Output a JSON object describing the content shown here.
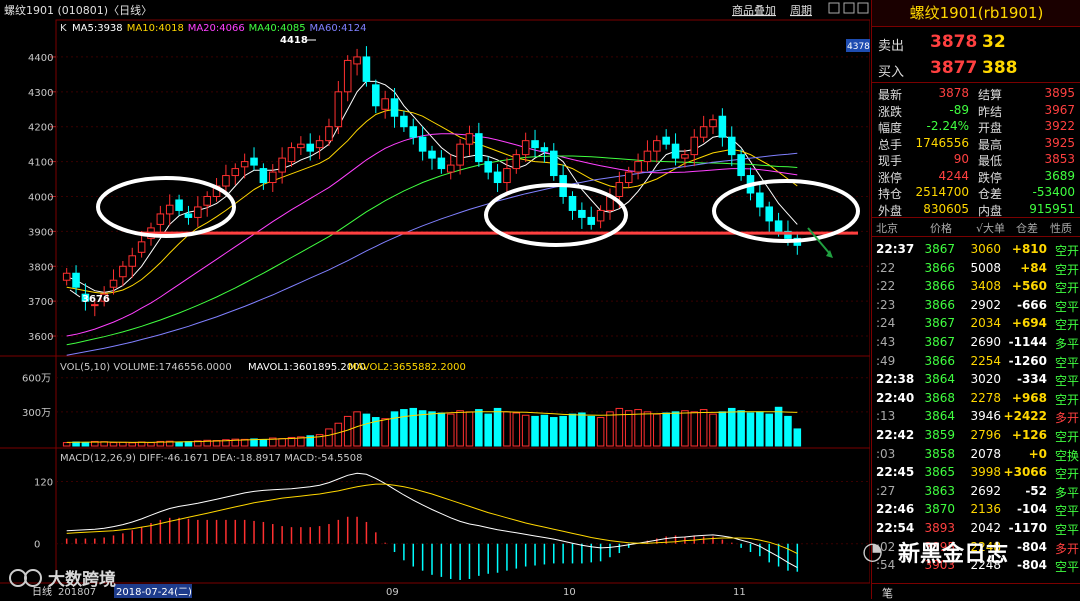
{
  "header": {
    "title": "螺纹1901 (010801)〈日线〉",
    "links": [
      "商品叠加",
      "周期"
    ],
    "ma_label": "K",
    "ma": [
      {
        "name": "MA5:3938",
        "color": "#ffffff"
      },
      {
        "name": "MA10:4018",
        "color": "#ffd700"
      },
      {
        "name": "MA20:4066",
        "color": "#ff40ff"
      },
      {
        "name": "MA40:4085",
        "color": "#40ff40"
      },
      {
        "name": "MA60:4124",
        "color": "#8080ff"
      }
    ],
    "price_tag": "4378"
  },
  "colors": {
    "up": "#ff3030",
    "down": "#00ffff",
    "support": "#ff4040",
    "arrow": "#20a040"
  },
  "chart_data": [
    {
      "type": "candlestick",
      "ylim": [
        3560,
        4460
      ],
      "yticks": [
        3600,
        3700,
        3800,
        3900,
        4000,
        4100,
        4200,
        4300,
        4400
      ],
      "high_label": "4418",
      "low_label": "3676",
      "support_level": 3895,
      "closes": [
        3780,
        3740,
        3700,
        3690,
        3720,
        3760,
        3800,
        3830,
        3870,
        3910,
        3950,
        3975,
        3960,
        3940,
        3970,
        4000,
        4030,
        4060,
        4080,
        4100,
        4090,
        4040,
        4070,
        4110,
        4140,
        4150,
        4130,
        4160,
        4200,
        4300,
        4390,
        4400,
        4330,
        4260,
        4280,
        4230,
        4200,
        4170,
        4130,
        4110,
        4080,
        4090,
        4150,
        4180,
        4100,
        4070,
        4040,
        4080,
        4120,
        4160,
        4140,
        4130,
        4060,
        4000,
        3960,
        3940,
        3920,
        3960,
        4000,
        4040,
        4070,
        4100,
        4130,
        4160,
        4150,
        4110,
        4120,
        4170,
        4200,
        4220,
        4170,
        4120,
        4060,
        4010,
        3970,
        3930,
        3900,
        3880,
        3860
      ],
      "opens": [
        3760,
        3780,
        3720,
        3690,
        3700,
        3740,
        3770,
        3800,
        3840,
        3880,
        3920,
        3950,
        3990,
        3950,
        3940,
        3975,
        4000,
        4030,
        4060,
        4085,
        4110,
        4080,
        4040,
        4070,
        4100,
        4140,
        4150,
        4140,
        4160,
        4200,
        4300,
        4380,
        4400,
        4320,
        4250,
        4280,
        4230,
        4200,
        4170,
        4130,
        4110,
        4070,
        4090,
        4150,
        4180,
        4100,
        4070,
        4040,
        4080,
        4120,
        4160,
        4140,
        4130,
        4060,
        4000,
        3960,
        3940,
        3930,
        3960,
        4000,
        4040,
        4070,
        4100,
        4130,
        4170,
        4150,
        4110,
        4120,
        4170,
        4200,
        4230,
        4170,
        4120,
        4060,
        4010,
        3970,
        3930,
        3900,
        3880
      ],
      "ma_series": [
        {
          "name": "MA5",
          "color": "#ffffff",
          "values": [
            3770,
            3760,
            3745,
            3730,
            3725,
            3730,
            3745,
            3770,
            3800,
            3840,
            3880,
            3920,
            3945,
            3955,
            3960,
            3968,
            3980,
            4000,
            4030,
            4060,
            4075,
            4075,
            4075,
            4080,
            4090,
            4105,
            4115,
            4130,
            4150,
            4200,
            4250,
            4300,
            4330,
            4330,
            4320,
            4300,
            4260,
            4230,
            4200,
            4170,
            4140,
            4120,
            4110,
            4115,
            4120,
            4115,
            4105,
            4090,
            4080,
            4090,
            4110,
            4125,
            4120,
            4100,
            4060,
            4020,
            3990,
            3960,
            3955,
            3965,
            3985,
            4015,
            4050,
            4090,
            4120,
            4130,
            4130,
            4135,
            4150,
            4170,
            4175,
            4165,
            4140,
            4100,
            4060,
            4020,
            3980,
            3950,
            3920
          ]
        },
        {
          "name": "MA10",
          "color": "#ffd700",
          "values": [
            3740,
            3735,
            3730,
            3725,
            3722,
            3725,
            3732,
            3745,
            3762,
            3785,
            3810,
            3838,
            3865,
            3890,
            3910,
            3925,
            3942,
            3960,
            3980,
            4000,
            4020,
            4035,
            4045,
            4055,
            4065,
            4075,
            4085,
            4095,
            4110,
            4135,
            4160,
            4190,
            4215,
            4235,
            4245,
            4250,
            4245,
            4240,
            4230,
            4215,
            4200,
            4185,
            4170,
            4160,
            4150,
            4140,
            4130,
            4120,
            4110,
            4105,
            4100,
            4098,
            4095,
            4090,
            4080,
            4065,
            4050,
            4040,
            4030,
            4025,
            4025,
            4030,
            4040,
            4050,
            4065,
            4080,
            4095,
            4105,
            4115,
            4125,
            4130,
            4135,
            4130,
            4120,
            4105,
            4090,
            4070,
            4050,
            4030
          ]
        },
        {
          "name": "MA20",
          "color": "#ff40ff",
          "values": [
            3600,
            3605,
            3612,
            3620,
            3630,
            3640,
            3652,
            3665,
            3680,
            3695,
            3712,
            3730,
            3748,
            3766,
            3784,
            3802,
            3820,
            3838,
            3856,
            3874,
            3892,
            3910,
            3928,
            3945,
            3962,
            3978,
            3994,
            4010,
            4026,
            4045,
            4065,
            4085,
            4105,
            4122,
            4138,
            4150,
            4160,
            4168,
            4174,
            4178,
            4180,
            4180,
            4178,
            4176,
            4172,
            4168,
            4162,
            4155,
            4148,
            4140,
            4133,
            4127,
            4120,
            4113,
            4106,
            4100,
            4094,
            4088,
            4083,
            4078,
            4074,
            4071,
            4069,
            4068,
            4068,
            4069,
            4070,
            4072,
            4074,
            4076,
            4078,
            4080,
            4080,
            4079,
            4077,
            4074,
            4070,
            4066,
            4062
          ]
        },
        {
          "name": "MA40",
          "color": "#40ff40",
          "values": [
            3575,
            3580,
            3586,
            3592,
            3598,
            3605,
            3612,
            3620,
            3628,
            3637,
            3646,
            3656,
            3666,
            3677,
            3688,
            3700,
            3712,
            3725,
            3738,
            3752,
            3766,
            3780,
            3795,
            3810,
            3825,
            3840,
            3855,
            3870,
            3885,
            3902,
            3920,
            3938,
            3956,
            3972,
            3988,
            4002,
            4016,
            4028,
            4040,
            4050,
            4060,
            4068,
            4076,
            4083,
            4090,
            4096,
            4101,
            4105,
            4109,
            4112,
            4114,
            4115,
            4116,
            4116,
            4116,
            4115,
            4114,
            4112,
            4110,
            4108,
            4106,
            4104,
            4102,
            4101,
            4100,
            4099,
            4098,
            4097,
            4096,
            4096,
            4095,
            4094,
            4093,
            4092,
            4090,
            4088,
            4086,
            4085,
            4083
          ]
        },
        {
          "name": "MA60",
          "color": "#8080ff",
          "values": [
            3545,
            3550,
            3555,
            3560,
            3565,
            3571,
            3577,
            3583,
            3590,
            3597,
            3604,
            3612,
            3620,
            3628,
            3637,
            3646,
            3655,
            3665,
            3675,
            3685,
            3696,
            3707,
            3718,
            3730,
            3742,
            3754,
            3766,
            3778,
            3790,
            3803,
            3816,
            3830,
            3844,
            3857,
            3870,
            3882,
            3894,
            3905,
            3916,
            3926,
            3936,
            3945,
            3954,
            3963,
            3971,
            3979,
            3987,
            3994,
            4001,
            4008,
            4014,
            4020,
            4026,
            4031,
            4036,
            4041,
            4046,
            4050,
            4054,
            4058,
            4062,
            4066,
            4070,
            4074,
            4078,
            4082,
            4086,
            4090,
            4094,
            4098,
            4101,
            4104,
            4107,
            4110,
            4113,
            4116,
            4119,
            4121,
            4124
          ]
        }
      ]
    },
    {
      "type": "bar",
      "title": "VOL(5,10) VOLUME:1746556.0000",
      "labels": [
        "MAVOL1:3601895.2000",
        "MAVOL2:3655882.2000"
      ],
      "yticks_text": [
        "600万",
        "300万"
      ],
      "ylim": [
        0,
        650
      ],
      "values": [
        30,
        35,
        30,
        40,
        38,
        30,
        32,
        28,
        35,
        30,
        40,
        42,
        35,
        38,
        45,
        50,
        48,
        55,
        60,
        58,
        62,
        55,
        70,
        65,
        75,
        80,
        90,
        100,
        150,
        200,
        260,
        300,
        280,
        250,
        240,
        300,
        320,
        330,
        310,
        300,
        290,
        280,
        310,
        300,
        320,
        280,
        330,
        300,
        290,
        270,
        260,
        270,
        250,
        260,
        280,
        290,
        260,
        250,
        300,
        330,
        310,
        320,
        300,
        280,
        290,
        300,
        310,
        300,
        320,
        280,
        300,
        330,
        310,
        290,
        300,
        280,
        340,
        260,
        150
      ],
      "mavol": [
        32,
        33,
        34,
        34,
        35,
        34,
        33,
        32,
        33,
        32,
        34,
        35,
        36,
        37,
        39,
        41,
        44,
        46,
        50,
        53,
        56,
        58,
        60,
        63,
        66,
        70,
        75,
        82,
        95,
        115,
        140,
        170,
        195,
        215,
        230,
        245,
        258,
        268,
        276,
        282,
        288,
        292,
        295,
        298,
        300,
        300,
        301,
        300,
        298,
        296,
        292,
        288,
        283,
        278,
        274,
        272,
        271,
        270,
        271,
        274,
        277,
        280,
        282,
        284,
        286,
        288,
        290,
        292,
        294,
        295,
        297,
        299,
        300,
        300,
        301,
        300,
        300,
        298,
        295
      ]
    },
    {
      "type": "bar",
      "title": "MACD(12,26,9) DIFF:-46.1671 DEA:-18.8917 MACD:-54.5508",
      "yticks": [
        120,
        0
      ],
      "ylim": [
        -70,
        150
      ],
      "diff": [
        25,
        26,
        27,
        28,
        30,
        33,
        37,
        42,
        48,
        55,
        62,
        68,
        72,
        75,
        78,
        82,
        86,
        90,
        94,
        98,
        101,
        103,
        104,
        105,
        106,
        108,
        110,
        113,
        118,
        125,
        132,
        136,
        134,
        126,
        116,
        105,
        94,
        84,
        75,
        66,
        58,
        50,
        43,
        38,
        35,
        31,
        27,
        24,
        21,
        18,
        15,
        12,
        9,
        5,
        1,
        -3,
        -6,
        -8,
        -7,
        -5,
        -2,
        1,
        4,
        7,
        10,
        12,
        13,
        15,
        16,
        17,
        15,
        12,
        7,
        2,
        -5,
        -15,
        -25,
        -36,
        -46
      ],
      "dea": [
        20,
        21,
        22,
        23,
        24,
        25,
        27,
        29,
        32,
        35,
        39,
        43,
        47,
        51,
        55,
        59,
        63,
        67,
        71,
        75,
        79,
        82,
        85,
        88,
        90,
        92,
        94,
        96,
        99,
        102,
        106,
        110,
        113,
        115,
        115,
        113,
        110,
        106,
        101,
        96,
        90,
        84,
        78,
        72,
        66,
        60,
        55,
        50,
        45,
        40,
        36,
        32,
        28,
        24,
        20,
        16,
        12,
        9,
        6,
        4,
        2,
        1,
        1,
        2,
        3,
        4,
        6,
        7,
        9,
        10,
        11,
        11,
        11,
        10,
        7,
        3,
        -3,
        -10,
        -19
      ],
      "macd": [
        10,
        10,
        10,
        10,
        12,
        16,
        20,
        26,
        32,
        40,
        46,
        50,
        50,
        48,
        46,
        46,
        46,
        46,
        46,
        46,
        44,
        42,
        38,
        34,
        32,
        32,
        32,
        34,
        38,
        46,
        52,
        52,
        42,
        22,
        2,
        -16,
        -32,
        -44,
        -52,
        -60,
        -64,
        -68,
        -70,
        -68,
        -62,
        -58,
        -56,
        -52,
        -48,
        -44,
        -42,
        -40,
        -38,
        -38,
        -38,
        -38,
        -36,
        -34,
        -26,
        -18,
        -8,
        0,
        6,
        10,
        14,
        16,
        14,
        16,
        14,
        14,
        8,
        2,
        -8,
        -16,
        -24,
        -36,
        -44,
        -52,
        -54
      ]
    }
  ],
  "xaxis": {
    "label": "日线",
    "items": [
      "201807",
      "2018-07-24(二)",
      "09",
      "10",
      "11"
    ]
  },
  "side": {
    "title": "螺纹1901(rb1901)",
    "sell": {
      "label": "卖出",
      "price": "3878",
      "vol": "32"
    },
    "buy": {
      "label": "买入",
      "price": "3877",
      "vol": "388"
    },
    "stats": [
      [
        "最新",
        "3878",
        "结算",
        "3895"
      ],
      [
        "涨跌",
        "-89",
        "昨结",
        "3967"
      ],
      [
        "幅度",
        "-2.24%",
        "开盘",
        "3922"
      ],
      [
        "总手",
        "1746556",
        "最高",
        "3925"
      ],
      [
        "现手",
        "90",
        "最低",
        "3853"
      ],
      [
        "涨停",
        "4244",
        "跌停",
        "3689"
      ],
      [
        "持仓",
        "2514700",
        "仓差",
        "-53400"
      ],
      [
        "外盘",
        "830605",
        "内盘",
        "915951"
      ]
    ],
    "ticks_header": [
      "北京",
      "价格",
      "√大单",
      "仓差",
      "性质"
    ],
    "ticks": [
      [
        "22:37",
        "3867",
        "3060",
        "+810",
        "空开"
      ],
      [
        ":22",
        "3866",
        "5008",
        "+84",
        "空开"
      ],
      [
        ":22",
        "3866",
        "3408",
        "+560",
        "空开"
      ],
      [
        ":23",
        "3866",
        "2902",
        "-666",
        "空平"
      ],
      [
        ":24",
        "3867",
        "2034",
        "+694",
        "空开"
      ],
      [
        ":43",
        "3867",
        "2690",
        "-1144",
        "多平"
      ],
      [
        ":49",
        "3866",
        "2254",
        "-1260",
        "空平"
      ],
      [
        "22:38",
        "3864",
        "3020",
        "-334",
        "空平"
      ],
      [
        "22:40",
        "3868",
        "2278",
        "+968",
        "空开"
      ],
      [
        ":13",
        "3864",
        "3946",
        "+2422",
        "多开"
      ],
      [
        "22:42",
        "3859",
        "2796",
        "+126",
        "空开"
      ],
      [
        ":03",
        "3858",
        "2078",
        "+0",
        "空换"
      ],
      [
        "22:45",
        "3865",
        "3998",
        "+3066",
        "空开"
      ],
      [
        ":27",
        "3863",
        "2692",
        "-52",
        "多平"
      ],
      [
        "22:46",
        "3870",
        "2136",
        "-104",
        "空平"
      ],
      [
        "22:54",
        "3893",
        "2042",
        "-1170",
        "空平"
      ],
      [
        ":02",
        "3895",
        "2248",
        "-804",
        "多开"
      ],
      [
        ":54",
        "3903",
        "2248",
        "-804",
        "空平"
      ]
    ],
    "bottom_tab": "笔"
  },
  "watermarks": {
    "left": "大数跨境",
    "right": "新黑金日志"
  }
}
